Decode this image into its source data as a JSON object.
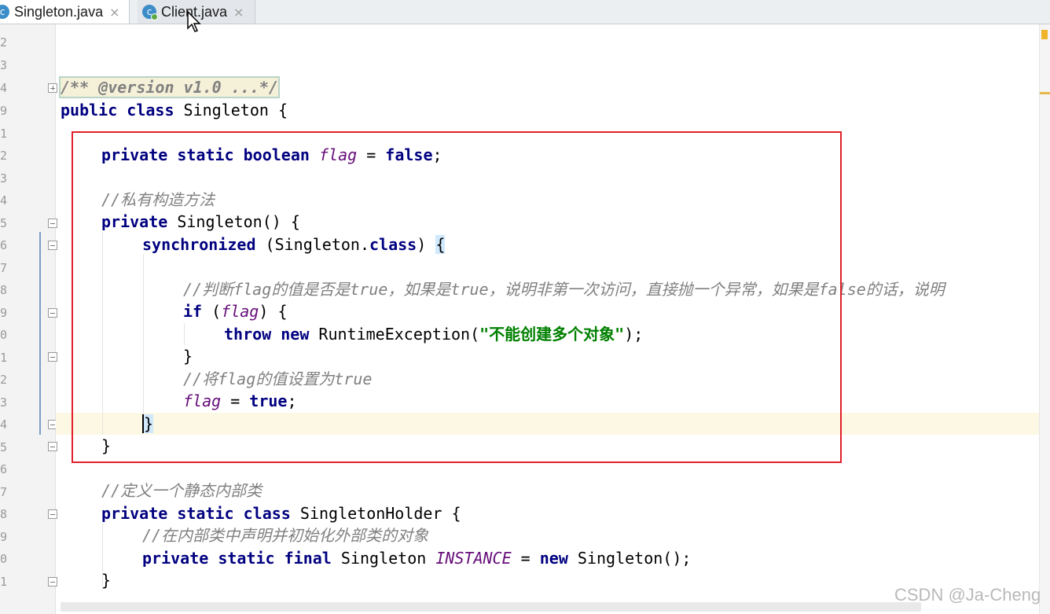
{
  "tabs": [
    {
      "label": "Singleton.java",
      "icon": "java-class-icon",
      "close": "×"
    },
    {
      "label": "Client.java",
      "icon": "java-class-icon",
      "close": "×"
    }
  ],
  "gutter_numbers": [
    "2",
    "3",
    "4",
    "9",
    "1",
    "2",
    "3",
    "4",
    "5",
    "6",
    "7",
    "8",
    "9",
    "0",
    "1",
    "2",
    "3",
    "4",
    "5",
    "6",
    "7",
    "8",
    "9",
    "0",
    "1"
  ],
  "code": {
    "doc_comment": "/** @version v1.0 ...*/",
    "class_decl": {
      "kw1": "public",
      "kw2": "class",
      "name": " Singleton {"
    },
    "flag_decl": {
      "kw1": "private",
      "kw2": "static",
      "kw3": "boolean",
      "field": "flag",
      "op": " = ",
      "val": "false",
      "end": ";"
    },
    "comment_ctor": "//私有构造方法",
    "ctor_decl": {
      "kw": "private",
      "rest": " Singleton() {"
    },
    "sync": {
      "kw": "synchronized",
      "mid": " (Singleton.",
      "kw2": "class",
      "end": ") ",
      "brace": "{"
    },
    "comment_check": "//判断flag的值是否是true，如果是true，说明非第一次访问，直接抛一个异常，如果是false的话，说明",
    "if_line": {
      "kw": "if",
      "open": " (",
      "field": "flag",
      "close": ") {"
    },
    "throw_line": {
      "kw1": "throw",
      "kw2": "new",
      "cls": " RuntimeException(",
      "str": "\"不能创建多个对象\"",
      "end": ");"
    },
    "close_if": "}",
    "comment_set": "//将flag的值设置为true",
    "assign": {
      "field": "flag",
      "op": " = ",
      "val": "true",
      "end": ";"
    },
    "close_sync": "}",
    "close_ctor": "}",
    "comment_holder": "//定义一个静态内部类",
    "holder_decl": {
      "kw1": "private",
      "kw2": "static",
      "kw3": "class",
      "rest": " SingletonHolder {"
    },
    "comment_inner": "//在内部类中声明并初始化外部类的对象",
    "instance_line": {
      "kw1": "private",
      "kw2": "static",
      "kw3": "final",
      "cls": " Singleton ",
      "field": "INSTANCE",
      "op": " = ",
      "kw4": "new",
      "rest": " Singleton();"
    },
    "close_holder": "}"
  },
  "watermark": "CSDN @Ja-Cheng",
  "colors": {
    "highlight_box": "#e0202a",
    "keyword": "#000080",
    "field": "#660e7a",
    "string": "#008000",
    "comment": "#808080"
  }
}
